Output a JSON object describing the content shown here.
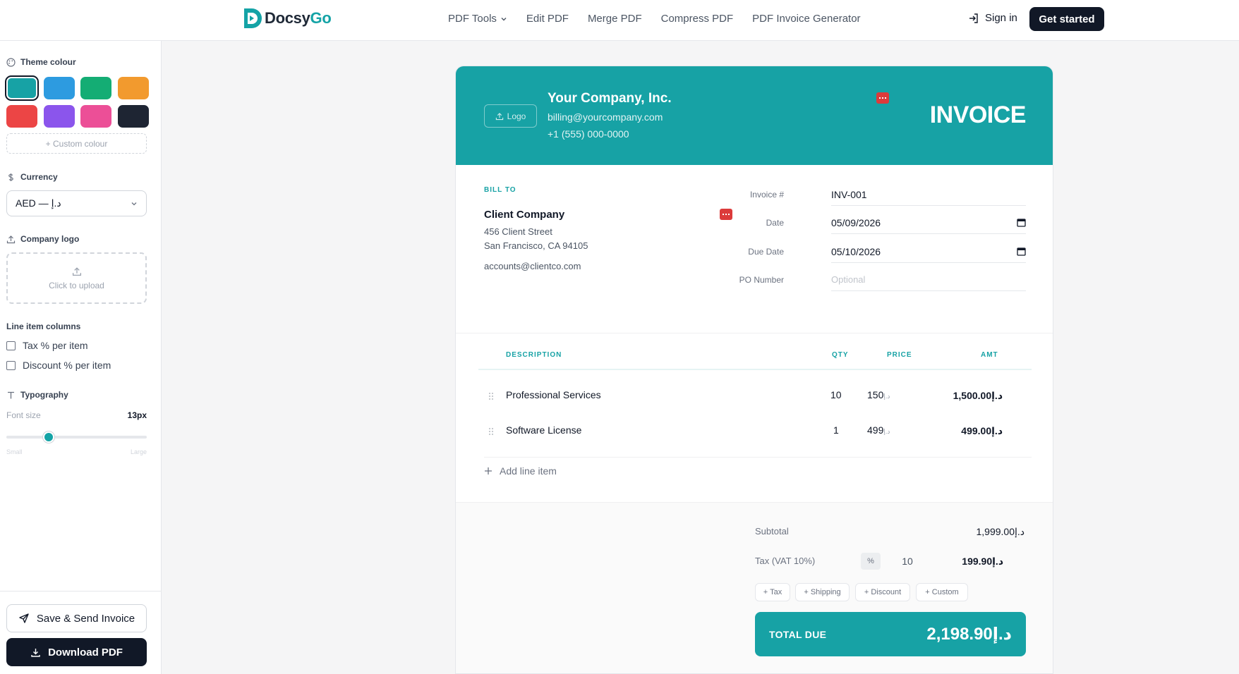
{
  "brand": {
    "name_main": "Docsy",
    "name_accent": "Go"
  },
  "nav": {
    "items": [
      "PDF Tools",
      "Edit PDF",
      "Merge PDF",
      "Compress PDF",
      "PDF Invoice Generator"
    ],
    "sign_in": "Sign in",
    "get_started": "Get started"
  },
  "sidebar": {
    "theme_label": "Theme colour",
    "swatches": [
      "#17a2a5",
      "#2d9be0",
      "#14ad74",
      "#f29a2e",
      "#ec4545",
      "#8b55ec",
      "#ec4f97",
      "#1e2533"
    ],
    "selected_swatch": 0,
    "custom_colour": "+ Custom colour",
    "currency_label": "Currency",
    "currency_value": "AED — د.إ",
    "logo_label": "Company logo",
    "upload_text": "Click to upload",
    "line_item_columns_label": "Line item columns",
    "tax_per_item": "Tax % per item",
    "discount_per_item": "Discount % per item",
    "typography_label": "Typography",
    "font_size_label": "Font size",
    "font_size_value": "13px",
    "font_size_fraction": 0.3,
    "slider_small": "Small",
    "slider_large": "Large",
    "save_send": "Save & Send Invoice",
    "download": "Download PDF"
  },
  "invoice": {
    "logo_button": "Logo",
    "company_name": "Your Company, Inc.",
    "company_email": "billing@yourcompany.com",
    "company_phone": "+1 (555) 000-0000",
    "title": "INVOICE",
    "bill_to_label": "BILL TO",
    "client_name": "Client Company",
    "client_street": "456 Client Street",
    "client_city": "San Francisco, CA 94105",
    "client_email": "accounts@clientco.com",
    "invoice_no_label": "Invoice #",
    "invoice_no": "INV-001",
    "date_label": "Date",
    "date": "05/09/2026",
    "due_date_label": "Due Date",
    "due_date": "05/10/2026",
    "po_label": "PO Number",
    "po_placeholder": "Optional",
    "columns": {
      "description": "DESCRIPTION",
      "qty": "QTY",
      "price": "PRICE",
      "amount": "AMT"
    },
    "items": [
      {
        "description": "Professional Services",
        "qty": "10",
        "price": "150",
        "amount": "1,500.00د.إ"
      },
      {
        "description": "Software License",
        "qty": "1",
        "price": "499",
        "amount": "499.00د.إ"
      }
    ],
    "add_line_item": "Add line item",
    "subtotal_label": "Subtotal",
    "subtotal": "1,999.00د.إ",
    "tax_label": "Tax (VAT 10%)",
    "tax_unit": "%",
    "tax_rate": "10",
    "tax_amount": "199.90د.إ",
    "chips": [
      "+ Tax",
      "+ Shipping",
      "+ Discount",
      "+ Custom"
    ],
    "total_due_label": "TOTAL DUE",
    "total_due": "2,198.90د.إ"
  }
}
